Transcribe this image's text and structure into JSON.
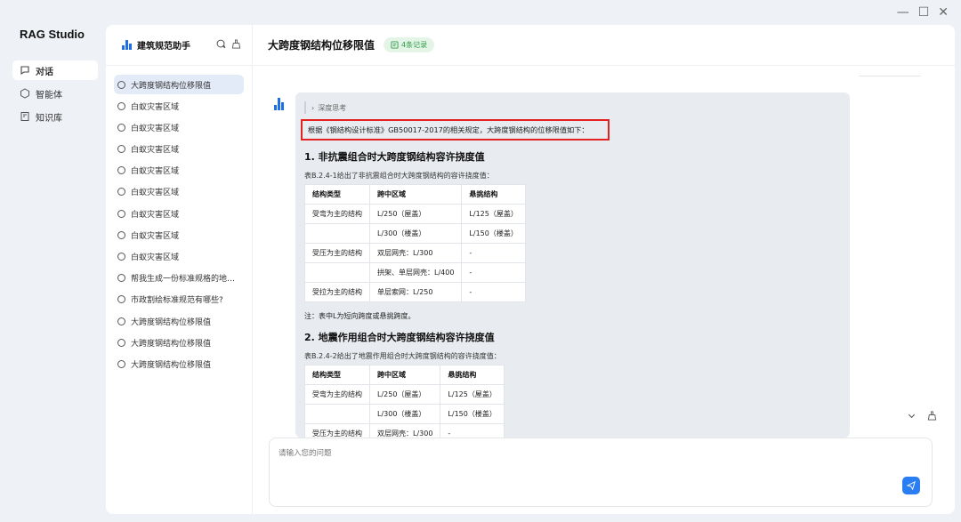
{
  "app": {
    "title": "RAG Studio"
  },
  "window": {
    "minimize": "—",
    "maximize": "☐",
    "close": "✕"
  },
  "nav": [
    {
      "label": "对话",
      "icon": "chat-icon",
      "active": true
    },
    {
      "label": "智能体",
      "icon": "agent-icon",
      "active": false
    },
    {
      "label": "知识库",
      "icon": "knowledge-base-icon",
      "active": false
    }
  ],
  "assistant": {
    "name": "建筑规范助手"
  },
  "chats": [
    "大跨度钢结构位移限值",
    "白蚁灾害区域",
    "白蚁灾害区域",
    "白蚁灾害区域",
    "白蚁灾害区域",
    "白蚁灾害区域",
    "白蚁灾害区域",
    "白蚁灾害区域",
    "白蚁灾害区域",
    "帮我生成一份标准规格的地…",
    "市政割绘标准规范有哪些?",
    "大跨度钢结构位移限值",
    "大跨度钢结构位移限值",
    "大跨度钢结构位移限值"
  ],
  "conversation": {
    "title": "大跨度钢结构位移限值",
    "badge": "4条记录"
  },
  "answer": {
    "think_label": "深度思考",
    "intro": "根据《钢结构设计标准》GB50017-2017的相关规定，大跨度钢结构的位移限值如下：",
    "section1": {
      "title": "1. 非抗震组合时大跨度钢结构容许挠度值",
      "caption": "表B.2.4-1给出了非抗震组合时大跨度钢结构的容许挠度值：",
      "headers": [
        "结构类型",
        "跨中区域",
        "悬挑结构"
      ],
      "rows": [
        [
          "受弯为主的结构",
          "L/250（屋盖）",
          "L/125（屋盖）"
        ],
        [
          "",
          "L/300（楼盖）",
          "L/150（楼盖）"
        ],
        [
          "受压为主的结构",
          "双层网壳：L/300",
          "-"
        ],
        [
          "",
          "拱架、单层网壳：L/400",
          "-"
        ],
        [
          "受拉为主的结构",
          "单层索网：L/250",
          "-"
        ]
      ],
      "note": "注：表中L为短向跨度或悬挑跨度。"
    },
    "section2": {
      "title": "2. 地震作用组合时大跨度钢结构容许挠度值",
      "caption": "表B.2.4-2给出了地震作用组合时大跨度钢结构的容许挠度值：",
      "headers": [
        "结构类型",
        "跨中区域",
        "悬挑结构"
      ],
      "rows": [
        [
          "受弯为主的结构",
          "L/250（屋盖）",
          "L/125（屋盖）"
        ],
        [
          "",
          "L/300（楼盖）",
          "L/150（楼盖）"
        ],
        [
          "受压为主的结构",
          "双层网壳：L/300",
          "-"
        ]
      ]
    }
  },
  "input": {
    "placeholder": "请输入您的问题"
  }
}
